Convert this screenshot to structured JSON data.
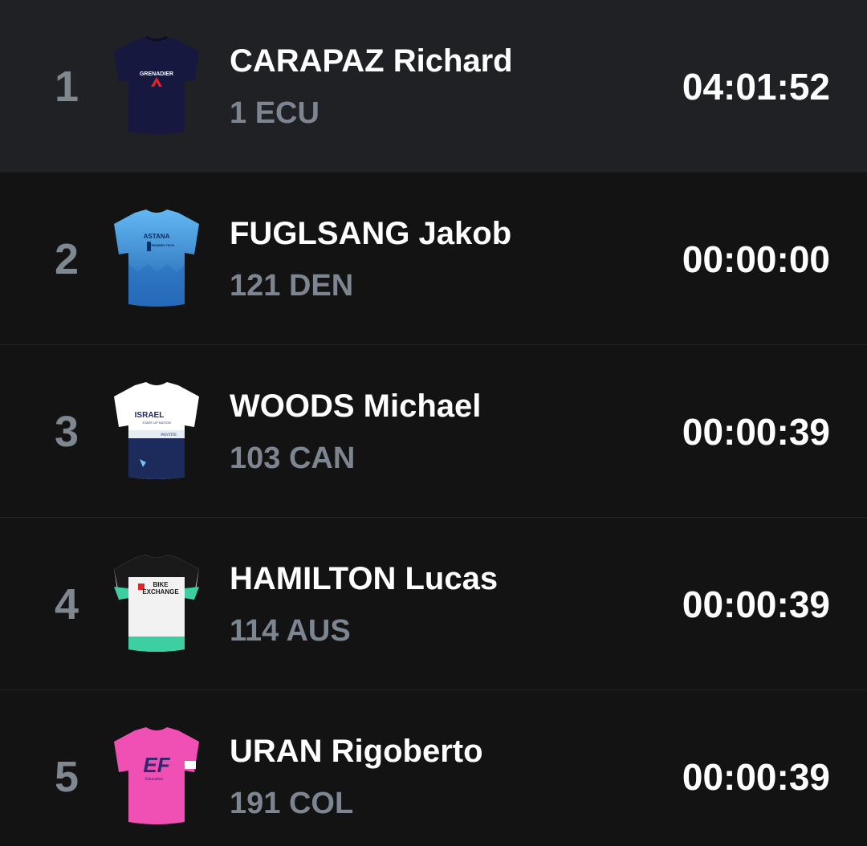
{
  "results": [
    {
      "rank": "1",
      "name": "CARAPAZ Richard",
      "meta": "1 ECU",
      "time": "04:01:52",
      "jersey": {
        "team_text": "GRENADIER",
        "primary": "#16183f",
        "accent": "#e2232a"
      }
    },
    {
      "rank": "2",
      "name": "FUGLSANG Jakob",
      "meta": "121 DEN",
      "time": "00:00:00",
      "jersey": {
        "team_text": "ASTANA",
        "subtext": "PREMIER TECH",
        "primary": "#4aa3e8",
        "accent": "#1c5fa8"
      }
    },
    {
      "rank": "3",
      "name": "WOODS Michael",
      "meta": "103 CAN",
      "time": "00:00:39",
      "jersey": {
        "team_text": "ISRAEL",
        "subtext": "START-UP NATION",
        "sponsor": "PANTINI",
        "primary": "#ffffff",
        "accent": "#1d2a5c"
      }
    },
    {
      "rank": "4",
      "name": "HAMILTON Lucas",
      "meta": "114 AUS",
      "time": "00:00:39",
      "jersey": {
        "team_text": "BIKE",
        "subtext": "EXCHANGE",
        "primary": "#f2f2f2",
        "accent": "#3ccfa2"
      }
    },
    {
      "rank": "5",
      "name": "URAN Rigoberto",
      "meta": "191 COL",
      "time": "00:00:39",
      "jersey": {
        "team_text": "EF",
        "subtext": "Education",
        "primary": "#f04fb4",
        "accent": "#2b2a6e"
      }
    }
  ]
}
